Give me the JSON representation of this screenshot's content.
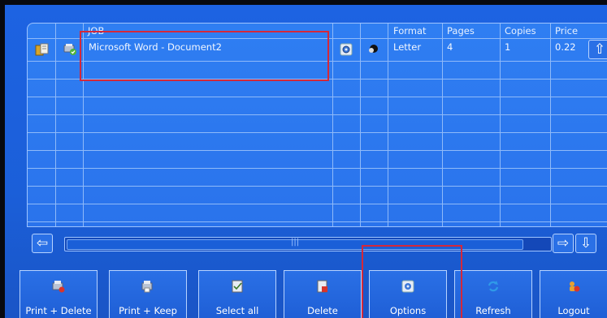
{
  "table": {
    "headers": {
      "job": "JOB",
      "format": "Format",
      "pages": "Pages",
      "copies": "Copies",
      "price": "Price"
    },
    "rows": [
      {
        "job": "Microsoft Word - Document2",
        "format": "Letter",
        "pages": "4",
        "copies": "1",
        "price": "0.22"
      }
    ]
  },
  "buttons": {
    "print_delete": "Print + Delete",
    "print_keep": "Print + Keep",
    "select_all": "Select all",
    "delete": "Delete",
    "options": "Options",
    "refresh": "Refresh",
    "logout": "Logout"
  },
  "scroll_markers": {
    "horizontal": "|||",
    "vertical": "≡"
  },
  "icons": {
    "row_document": "document-icon",
    "row_status": "printer-check-icon",
    "row_settings": "settings-icon",
    "row_color": "color-mode-icon",
    "scroll_up": "arrow-up-icon",
    "scroll_down": "arrow-down-icon",
    "scroll_left": "arrow-left-icon",
    "scroll_right": "arrow-right-icon"
  },
  "colors": {
    "background": "#1b5fd9",
    "grid_line": "#8fbaf9",
    "highlight": "#d4283a"
  }
}
